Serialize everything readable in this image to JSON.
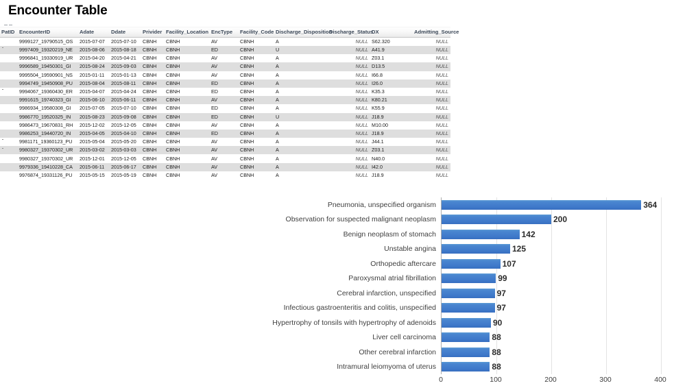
{
  "page": {
    "title": "Encounter Table"
  },
  "table": {
    "columns": [
      "PatID",
      "EncounterID",
      "Adate",
      "Ddate",
      "Privider",
      "Facility_Location",
      "EncType",
      "Facility_Code",
      "Discharge_Disposition",
      "Discharge_Status",
      "DX",
      "Admitting_Source"
    ],
    "rows": [
      [
        "",
        "9999127_19790515_OS",
        "2015-07-07",
        "2015-07-10",
        "CBNH",
        "CBNH",
        "AV",
        "CBNH",
        "A",
        "NULL",
        "S62.320",
        "NULL"
      ],
      [
        "",
        "9997409_19320219_NE",
        "2015-08-06",
        "2015-08-18",
        "CBNH",
        "CBNH",
        "ED",
        "CBNH",
        "U",
        "NULL",
        "A41.9",
        "NULL"
      ],
      [
        "",
        "9996841_19330919_UR",
        "2015-04-20",
        "2015-04-21",
        "CBNH",
        "CBNH",
        "AV",
        "CBNH",
        "A",
        "NULL",
        "Z03.1",
        "NULL"
      ],
      [
        "",
        "9996589_19450301_GI",
        "2015-08-24",
        "2015-09-03",
        "CBNH",
        "CBNH",
        "AV",
        "CBNH",
        "A",
        "NULL",
        "D13.5",
        "NULL"
      ],
      [
        "",
        "9995504_19590901_NS",
        "2015-01-11",
        "2015-01-13",
        "CBNH",
        "CBNH",
        "AV",
        "CBNH",
        "A",
        "NULL",
        "I66.8",
        "NULL"
      ],
      [
        "",
        "9994749_19450908_PU",
        "2015-08-04",
        "2015-08-11",
        "CBNH",
        "CBNH",
        "ED",
        "CBNH",
        "A",
        "NULL",
        "I26.0",
        "NULL"
      ],
      [
        "",
        "9994067_19360430_ER",
        "2015-04-07",
        "2015-04-24",
        "CBNH",
        "CBNH",
        "ED",
        "CBNH",
        "A",
        "NULL",
        "K35.3",
        "NULL"
      ],
      [
        "",
        "9991615_19740323_GI",
        "2015-06-10",
        "2015-06-11",
        "CBNH",
        "CBNH",
        "AV",
        "CBNH",
        "A",
        "NULL",
        "K80.21",
        "NULL"
      ],
      [
        "",
        "9986934_19580308_GI",
        "2015-07-05",
        "2015-07-10",
        "CBNH",
        "CBNH",
        "ED",
        "CBNH",
        "A",
        "NULL",
        "K55.9",
        "NULL"
      ],
      [
        "",
        "9986770_19520325_IN",
        "2015-08-23",
        "2015-09-08",
        "CBNH",
        "CBNH",
        "ED",
        "CBNH",
        "U",
        "NULL",
        "J18.9",
        "NULL"
      ],
      [
        "",
        "9986473_19670831_RH",
        "2015-12-02",
        "2015-12-05",
        "CBNH",
        "CBNH",
        "AV",
        "CBNH",
        "A",
        "NULL",
        "M10.00",
        "NULL"
      ],
      [
        "",
        "9986253_19440720_IN",
        "2015-04-05",
        "2015-04-10",
        "CBNH",
        "CBNH",
        "ED",
        "CBNH",
        "A",
        "NULL",
        "J18.9",
        "NULL"
      ],
      [
        "",
        "9981171_19360123_PU",
        "2015-05-04",
        "2015-05-20",
        "CBNH",
        "CBNH",
        "AV",
        "CBNH",
        "A",
        "NULL",
        "J44.1",
        "NULL"
      ],
      [
        "",
        "9980327_19370302_UR",
        "2015-03-02",
        "2015-03-03",
        "CBNH",
        "CBNH",
        "AV",
        "CBNH",
        "A",
        "NULL",
        "Z03.1",
        "NULL"
      ],
      [
        "",
        "9980327_19370302_UR",
        "2015-12-01",
        "2015-12-05",
        "CBNH",
        "CBNH",
        "AV",
        "CBNH",
        "A",
        "NULL",
        "N40.0",
        "NULL"
      ],
      [
        "",
        "9979336_19410228_CA",
        "2015-06-11",
        "2015-06-17",
        "CBNH",
        "CBNH",
        "AV",
        "CBNH",
        "A",
        "NULL",
        "I42.0",
        "NULL"
      ],
      [
        "",
        "9976874_19331126_PU",
        "2015-05-15",
        "2015-05-19",
        "CBNH",
        "CBNH",
        "AV",
        "CBNH",
        "A",
        "NULL",
        "J18.9",
        "NULL"
      ]
    ]
  },
  "chart_data": {
    "type": "bar",
    "orientation": "horizontal",
    "title": "",
    "xlabel": "",
    "ylabel": "",
    "xlim": [
      0,
      400
    ],
    "xticks": [
      0,
      100,
      200,
      300,
      400
    ],
    "grid": true,
    "legend": false,
    "bar_color": "#4472C4",
    "categories": [
      "Pneumonia, unspecified organism",
      "Observation for suspected malignant neoplasm",
      "Benign neoplasm of stomach",
      "Unstable angina",
      "Orthopedic aftercare",
      "Paroxysmal atrial fibrillation",
      "Cerebral infarction, unspecified",
      "Infectious gastroenteritis and colitis, unspecified",
      "Hypertrophy of tonsils with hypertrophy of adenoids",
      "Liver cell carcinoma",
      "Other cerebral infarction",
      "Intramural leiomyoma of uterus"
    ],
    "values": [
      364,
      200,
      142,
      125,
      107,
      99,
      97,
      97,
      90,
      88,
      88,
      88
    ]
  }
}
